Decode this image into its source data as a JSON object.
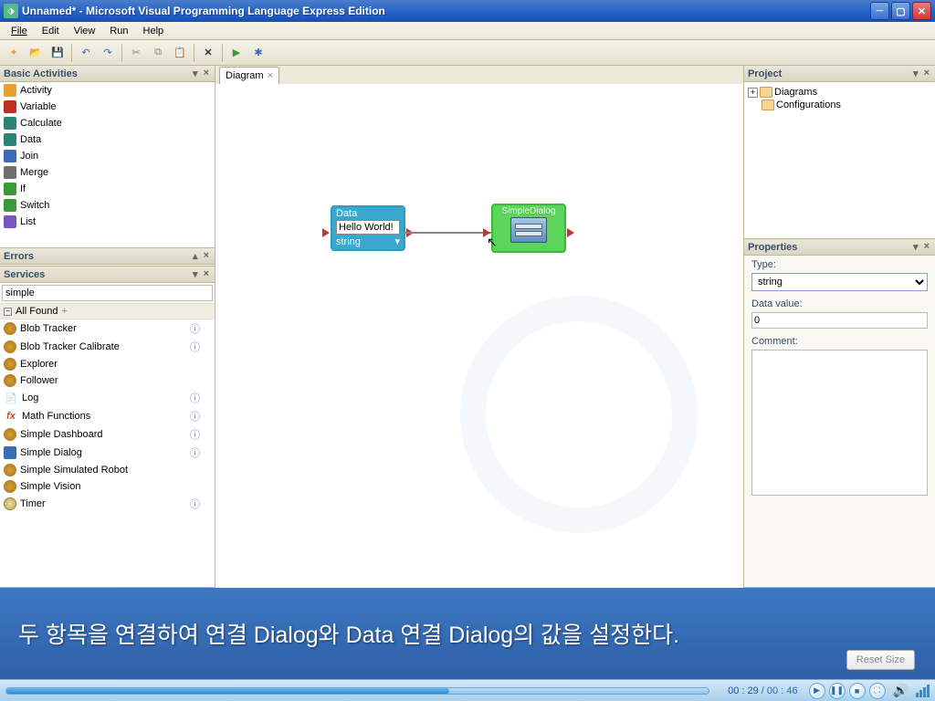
{
  "titlebar": {
    "title": "Unnamed* - Microsoft Visual Programming Language  Express Edition"
  },
  "menu": {
    "file": "File",
    "edit": "Edit",
    "view": "View",
    "run": "Run",
    "help": "Help"
  },
  "panels": {
    "basic_activities": {
      "title": "Basic Activities",
      "items": [
        {
          "label": "Activity"
        },
        {
          "label": "Variable"
        },
        {
          "label": "Calculate"
        },
        {
          "label": "Data"
        },
        {
          "label": "Join"
        },
        {
          "label": "Merge"
        },
        {
          "label": "If"
        },
        {
          "label": "Switch"
        },
        {
          "label": "List"
        }
      ]
    },
    "errors": {
      "title": "Errors"
    },
    "services": {
      "title": "Services",
      "search": "simple",
      "group": "All Found",
      "items": [
        {
          "label": "Blob Tracker",
          "info": true
        },
        {
          "label": "Blob Tracker Calibrate",
          "info": true
        },
        {
          "label": "Explorer"
        },
        {
          "label": "Follower"
        },
        {
          "label": "Log",
          "info": true
        },
        {
          "label": "Math Functions",
          "info": true
        },
        {
          "label": "Simple Dashboard",
          "info": true
        },
        {
          "label": "Simple Dialog",
          "info": true
        },
        {
          "label": "Simple Simulated Robot"
        },
        {
          "label": "Simple Vision"
        },
        {
          "label": "Timer",
          "info": true
        }
      ]
    },
    "project": {
      "title": "Project",
      "tree": [
        {
          "label": "Diagrams",
          "expandable": true
        },
        {
          "label": "Configurations",
          "expandable": false
        }
      ]
    },
    "properties": {
      "title": "Properties",
      "type_label": "Type:",
      "type_value": "string",
      "datavalue_label": "Data value:",
      "datavalue_value": "0",
      "comment_label": "Comment:",
      "comment_value": ""
    }
  },
  "diagram": {
    "tab": "Diagram",
    "data_node": {
      "title": "Data",
      "value": "Hello World!",
      "type": "string"
    },
    "dialog_node": {
      "title": "SimpleDialog"
    }
  },
  "caption": {
    "text": "두 항목을 연결하여 연결 Dialog와 Data 연결 Dialog의 값을 설정한다.",
    "reset": "Reset Size"
  },
  "player": {
    "current": "00 : 29",
    "total": "00 : 46",
    "progress_pct": 63
  }
}
